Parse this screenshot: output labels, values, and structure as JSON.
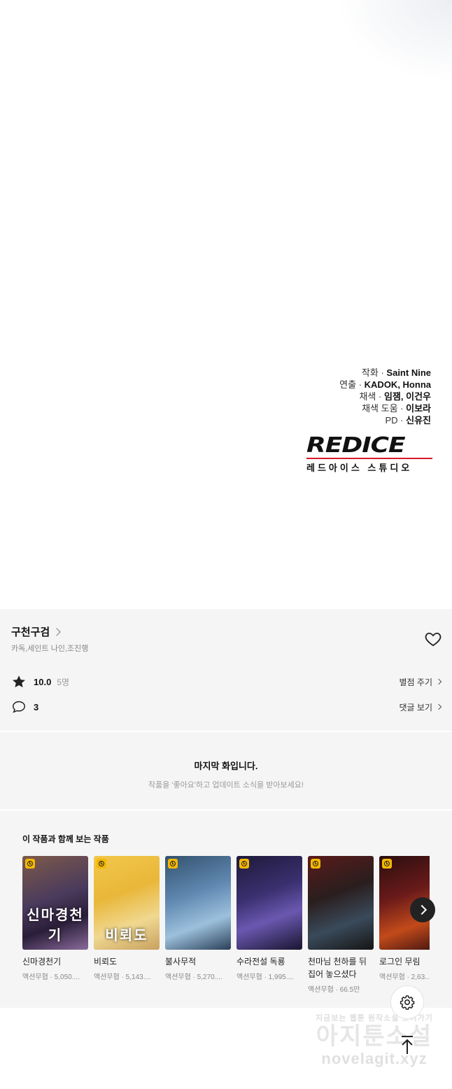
{
  "credits": [
    {
      "role": "작화 ·",
      "name": "Saint Nine"
    },
    {
      "role": "연출 ·",
      "name": "KADOK, Honna"
    },
    {
      "role": "채색 ·",
      "name": "임잼, 이건우"
    },
    {
      "role": "채색 도움 ·",
      "name": "이보라"
    },
    {
      "role": "PD ·",
      "name": "신유진"
    }
  ],
  "logo": {
    "word": "REDICE",
    "subtitle": "레드아이스 스튜디오"
  },
  "series": {
    "title": "구천구검",
    "authors": "카독,세인트 나인,조진행",
    "rating": "10.0",
    "rating_count": "5명",
    "rate_link": "별점 주기",
    "comments": "3",
    "comments_link": "댓글 보기"
  },
  "final": {
    "title": "마지막 화입니다.",
    "subtitle": "작품을 '좋아요'하고 업데이트 소식을 받아보세요!"
  },
  "recommendations": {
    "title": "이 작품과 함께 보는 작품",
    "items": [
      {
        "name": "신마경천기",
        "meta": "액션무협 · 5,050....",
        "cover_text": "신마경천기",
        "bg": "linear-gradient(160deg,#7d5a4a,#4a3a5c 45%,#2b1e3a 70%,#8a6b9a)"
      },
      {
        "name": "비뢰도",
        "meta": "액션무협 · 5,143....",
        "cover_text": "비뢰도",
        "bg": "linear-gradient(160deg,#f2c74a,#e9b73a 40%,#f0d890 70%,#c7a060)"
      },
      {
        "name": "불사무적",
        "meta": "액션무협 · 5,270....",
        "cover_text": "",
        "bg": "linear-gradient(160deg,#34526e,#5f87b0 40%,#9cc0dc 70%,#2b3f58)"
      },
      {
        "name": "수라전설 독룡",
        "meta": "액션무협 · 1,995....",
        "cover_text": "",
        "bg": "linear-gradient(160deg,#1e1a3a,#3b3070 40%,#6a58b0 65%,#1a1530)"
      },
      {
        "name": "천마님 천하를 뒤집어 놓으셨다",
        "meta": "액션무협 · 66.5만",
        "cover_text": "",
        "bg": "linear-gradient(160deg,#5a1a1a,#2a1e1e 40%,#3a4a5a 70%,#151515)"
      },
      {
        "name": "로그인 무림",
        "meta": "액션무협 · 2,63...",
        "cover_text": "",
        "bg": "linear-gradient(160deg,#2a0e0e,#6a1a1a 40%,#c24a1a 70%,#3a1010)"
      }
    ]
  },
  "watermark": {
    "line1": "지금보는 웹툰 원작소설 보러가기",
    "line2": "아지툰소설",
    "line3": "novelagit.xyz"
  }
}
